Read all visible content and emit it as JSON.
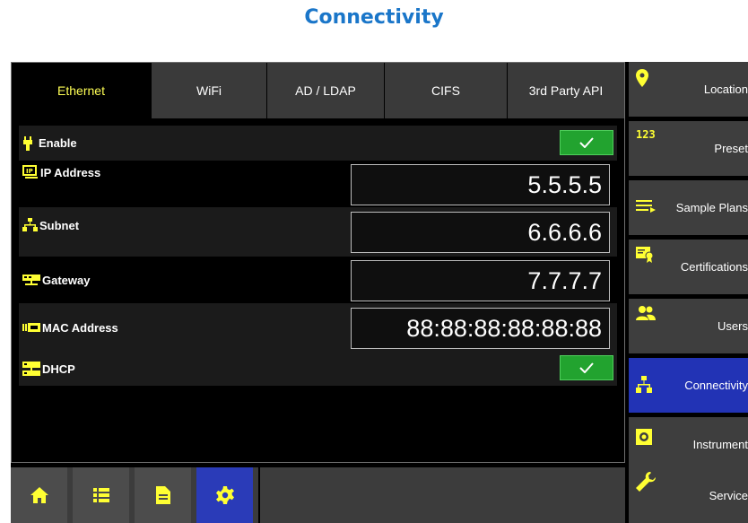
{
  "page": {
    "title": "Connectivity"
  },
  "tabs": [
    "Ethernet",
    "WiFi",
    "AD / LDAP",
    "CIFS",
    "3rd Party API"
  ],
  "rows": {
    "enable": {
      "label": "Enable",
      "checked": true
    },
    "ip": {
      "label": "IP Address",
      "value": "5.5.5.5"
    },
    "subnet": {
      "label": "Subnet",
      "value": "6.6.6.6"
    },
    "gateway": {
      "label": "Gateway",
      "value": "7.7.7.7"
    },
    "mac": {
      "label": "MAC Address",
      "value": "88:88:88:88:88:88"
    },
    "dhcp": {
      "label": "DHCP",
      "checked": true
    }
  },
  "sidebar": {
    "items": [
      {
        "label": "Location",
        "icon": "location-pin-icon"
      },
      {
        "label": "Preset",
        "icon": "123-icon"
      },
      {
        "label": "Sample Plans",
        "icon": "list-arrow-icon"
      },
      {
        "label": "Certifications",
        "icon": "certificate-icon"
      },
      {
        "label": "Users",
        "icon": "users-icon"
      },
      {
        "label": "Connectivity",
        "icon": "network-icon"
      },
      {
        "label": "Instrument",
        "icon": "instrument-icon"
      },
      {
        "label": "Service",
        "icon": "wrench-icon"
      }
    ],
    "active": "Connectivity"
  },
  "bottom_bar": {
    "buttons": [
      "home-icon",
      "list-icon",
      "document-icon",
      "gear-icon"
    ],
    "active": "gear-icon"
  },
  "colors": {
    "accent_yellow": "#ffff33",
    "active_blue": "#2233b5",
    "check_green": "#22a32f",
    "title_blue": "#1a76c9"
  }
}
